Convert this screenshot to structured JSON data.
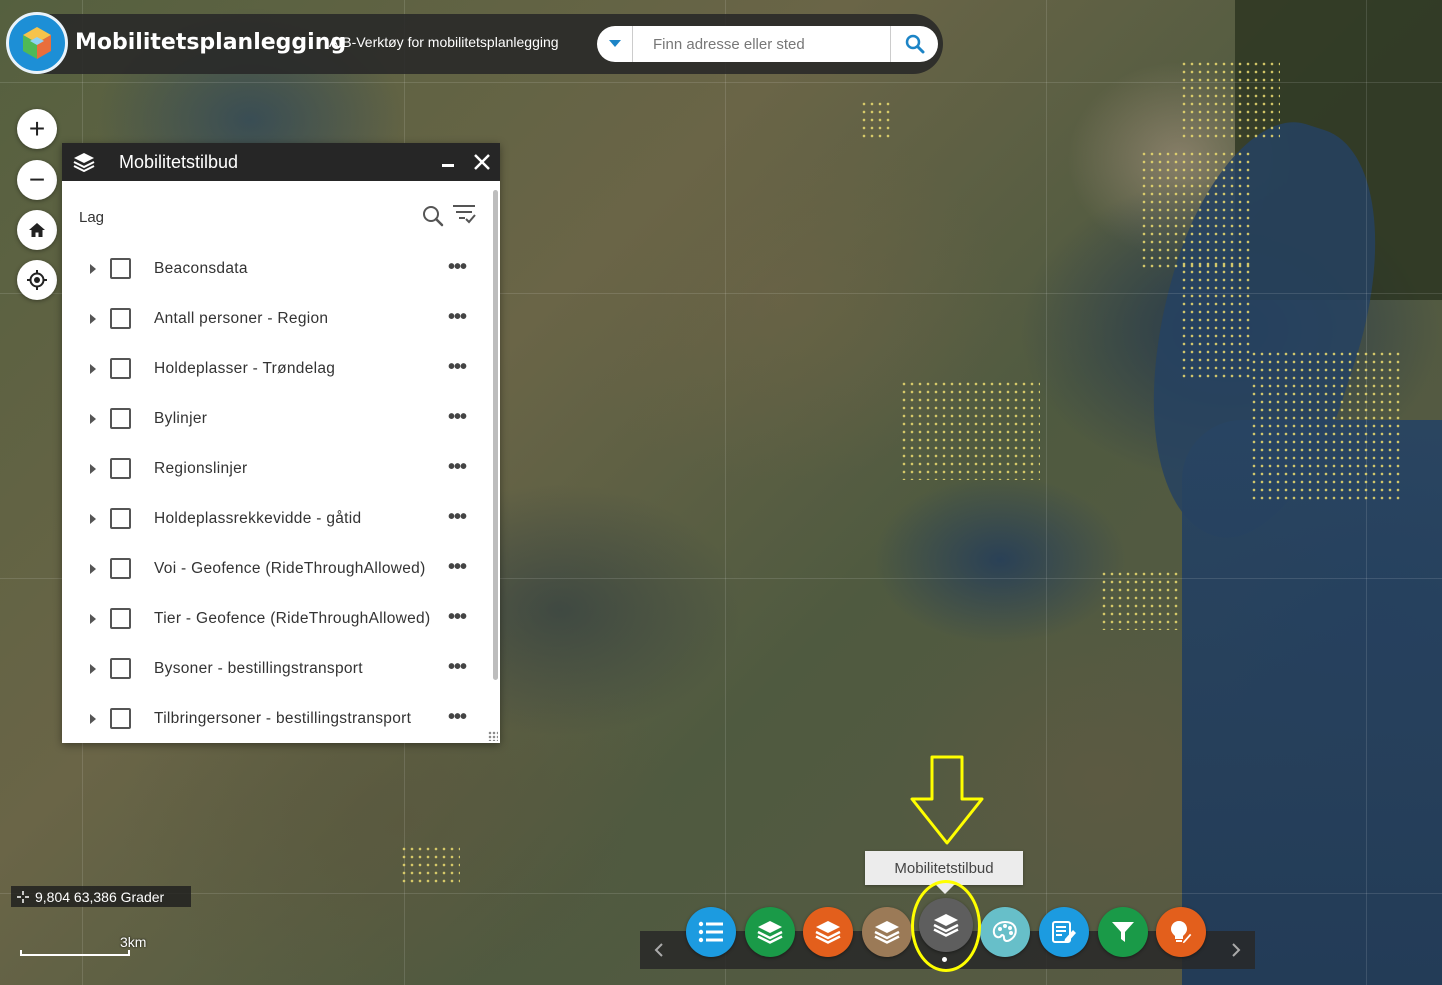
{
  "header": {
    "app_title": "Mobilitetsplanlegging",
    "app_subtitle": "AtB-Verktøy for mobilitetsplanlegging",
    "search_placeholder": "Finn adresse eller sted"
  },
  "map_controls": {
    "zoom_in": "+",
    "zoom_out": "−"
  },
  "layer_panel": {
    "title": "Mobilitetstilbud",
    "section_label": "Lag",
    "layers": [
      {
        "label": "Beaconsdata",
        "checked": false
      },
      {
        "label": "Antall personer - Region",
        "checked": false
      },
      {
        "label": "Holdeplasser - Trøndelag",
        "checked": false
      },
      {
        "label": "Bylinjer",
        "checked": false
      },
      {
        "label": "Regionslinjer",
        "checked": false
      },
      {
        "label": "Holdeplassrekkevidde - gåtid",
        "checked": false
      },
      {
        "label": "Voi - Geofence (RideThroughAllowed)",
        "checked": false
      },
      {
        "label": "Tier - Geofence (RideThroughAllowed)",
        "checked": false
      },
      {
        "label": "Bysoner - bestillingstransport",
        "checked": false
      },
      {
        "label": "Tilbringersoner - bestillingstransport",
        "checked": false
      }
    ],
    "more_glyph": "•••"
  },
  "coordinates": {
    "text": "9,804 63,386 Grader"
  },
  "scale_bar": {
    "label": "3km"
  },
  "toolbar": {
    "tooltip": "Mobilitetstilbud",
    "tools": [
      {
        "icon": "list-icon",
        "color": "#1c9be0"
      },
      {
        "icon": "layers-icon",
        "color": "#1a9a48"
      },
      {
        "icon": "layers-icon",
        "color": "#e35f1c"
      },
      {
        "icon": "layers-icon",
        "color": "#9b7a57"
      },
      {
        "icon": "layers-icon",
        "color": "#5e5e5e",
        "active": true
      },
      {
        "icon": "palette-icon",
        "color": "#67bfc9"
      },
      {
        "icon": "edit-icon",
        "color": "#1c9be0"
      },
      {
        "icon": "filter-icon",
        "color": "#1a9a48"
      },
      {
        "icon": "bulb-edit-icon",
        "color": "#e35f1c"
      }
    ],
    "highlight_color": "#ffff00"
  }
}
